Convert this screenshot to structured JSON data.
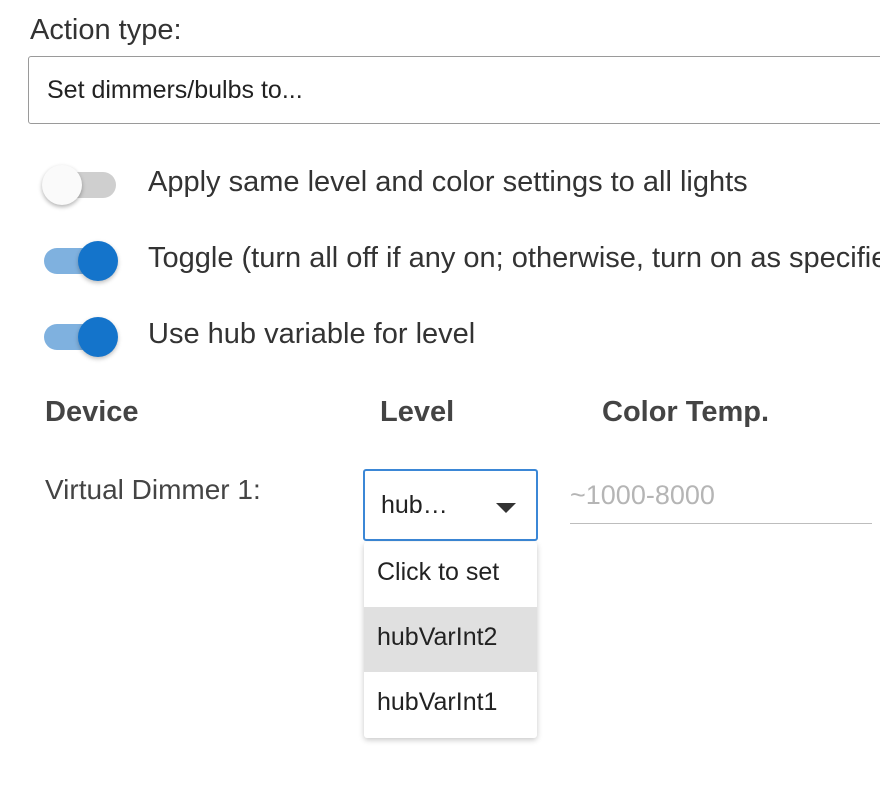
{
  "action": {
    "label": "Action type:",
    "selected": "Set dimmers/bulbs to..."
  },
  "switches": [
    {
      "label": "Apply same level and color settings to all lights",
      "on": false
    },
    {
      "label": "Toggle (turn all off if any on; otherwise, turn on as specified)",
      "on": true
    },
    {
      "label": "Use hub variable for level",
      "on": true
    }
  ],
  "table": {
    "headers": {
      "device": "Device",
      "level": "Level",
      "color_temp": "Color Temp."
    },
    "rows": [
      {
        "device": "Virtual Dimmer 1:",
        "level_value": "hub…",
        "color_temp_placeholder": "~1000-8000"
      }
    ]
  },
  "dropdown": {
    "options": [
      "Click to set",
      "hubVarInt2",
      "hubVarInt1"
    ],
    "highlighted": "hubVarInt2"
  },
  "colors": {
    "accent": "#1474cb",
    "accent_track": "#7fb1df",
    "focus_border": "#3b87d6",
    "highlight_bg": "#e0e0e0"
  },
  "icons": {
    "select_caret": "caret-down-icon"
  }
}
